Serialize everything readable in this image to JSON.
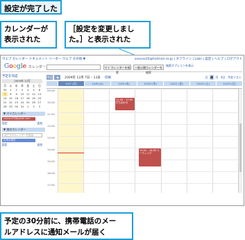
{
  "callouts": {
    "top": "設定が完了した",
    "left_line1": "カレンダーが",
    "left_line2": "表示された",
    "right_line1": "［設定を変更しまし",
    "right_line2": "た。］と表示された",
    "bottom_line1": "予定の30分前に、携帯電話のメー",
    "bottom_line2": "ルアドレスに通知メールが届く"
  },
  "app": {
    "topnav": "ウェブ カレンダー ドキュメント リーダー ウェブ その他 ▼",
    "account": "xxxxxx20@hotmail.co.jp | オフライン | Labs | 設定 | ヘルプ | ログアウト",
    "logo_text": "Google",
    "logo_sub": "カレンダー",
    "btn_search": "マイ カレンダーを検索",
    "btn_public": "一般公開カレンダーを検索",
    "search_opts1": "検索オプションを表示",
    "search_opts2": "検索オプションを表示"
  },
  "sidebar": {
    "quick_add": "予定を作成",
    "quick_add2": "クイック追加",
    "minical_title": "2009年 12月",
    "weekdays": [
      "月",
      "火",
      "水",
      "木",
      "金",
      "土",
      "日"
    ],
    "days": [
      "30",
      "1",
      "2",
      "3",
      "4",
      "5",
      "6",
      "7",
      "8",
      "9",
      "10",
      "11",
      "12",
      "13",
      "14",
      "15",
      "16",
      "17",
      "18",
      "19",
      "20",
      "21",
      "22",
      "23",
      "24",
      "25",
      "26",
      "27",
      "28",
      "29",
      "30",
      "31",
      "1",
      "2",
      "3"
    ],
    "today_index": 7,
    "my_cal_header": "▼ マイカレンダー",
    "my_cal_item": "xxxxxx20@gmail.com",
    "my_cal_add": "追加",
    "my_cal_settings": "設定",
    "other_header": "▼ 他のカレンダー",
    "other_placeholder": "友だちのカレンダーを追加",
    "other_item": "日本の祝日",
    "other_add": "追加",
    "other_settings": "設定"
  },
  "main": {
    "today_btn": "今日",
    "date_range": "2009年 12月 7日 – 13日",
    "print": "印刷",
    "views": [
      "日",
      "週",
      "月",
      "4日",
      "予定リスト"
    ],
    "selected_view_index": 1,
    "days": [
      "12/7 (月)",
      "12/8 (火)",
      "12/9 (水)",
      "12/10 (木)",
      "12/11 (金)",
      "12/12 (土)",
      "12/13 (日)"
    ],
    "times": [
      "09:00",
      "10:00",
      "11:00",
      "12:00",
      "13:00",
      "14:00",
      "15:00",
      "16:00",
      "17:00"
    ],
    "event1": "12:00 – 13:00 打ち合わせ",
    "event2": "15:00 – 16:00 ミーティング",
    "popup_text": "設定を変更しました。",
    "popup_btn": "閉じる"
  }
}
